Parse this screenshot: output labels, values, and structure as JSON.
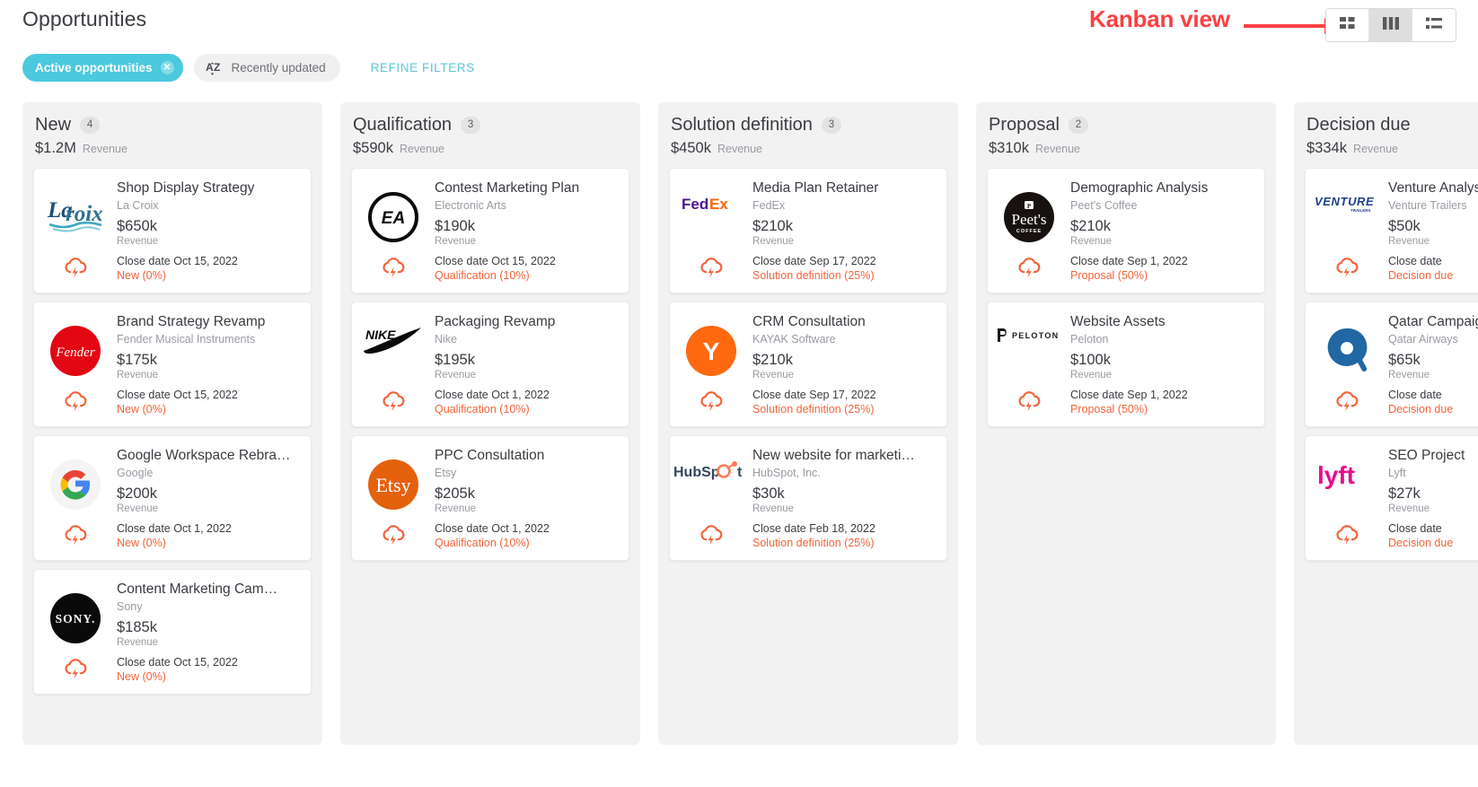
{
  "header": {
    "title": "Opportunities",
    "filters": {
      "active_chip": "Active opportunities",
      "chip_close_icon": "close-circle-icon",
      "sort_icon": "sort-az-icon",
      "sort_label": "Recently updated",
      "refine_link": "REFINE FILTERS"
    },
    "view_toggle": {
      "buttons": [
        {
          "name": "grid-view",
          "icon": "grid-view-icon",
          "selected": false
        },
        {
          "name": "kanban-view",
          "icon": "kanban-view-icon",
          "selected": true
        },
        {
          "name": "list-view",
          "icon": "list-view-icon",
          "selected": false
        }
      ]
    },
    "annotation": {
      "label": "Kanban view",
      "color": "#fc4043",
      "icon": "arrow-right-icon"
    }
  },
  "colors": {
    "accent_teal": "#4BC9DE",
    "stage_orange": "#f4633a",
    "column_bg": "#f2f2f2",
    "annotation_red": "#fc4043"
  },
  "revenue_label": "Revenue",
  "board": {
    "columns": [
      {
        "title": "New",
        "count": "4",
        "revenue": "$1.2M",
        "revenue_label": "Revenue",
        "cards": [
          {
            "title": "Shop Display Strategy",
            "company": "La Croix",
            "amount": "$650k",
            "amount_label": "Revenue",
            "close_date": "Close date Oct 15, 2022",
            "stage": "New (0%)",
            "logo": "lacroix-logo"
          },
          {
            "title": "Brand Strategy Revamp",
            "company": "Fender Musical Instruments",
            "amount": "$175k",
            "amount_label": "Revenue",
            "close_date": "Close date Oct 15, 2022",
            "stage": "New (0%)",
            "logo": "fender-logo"
          },
          {
            "title": "Google Workspace Rebra…",
            "company": "Google",
            "amount": "$200k",
            "amount_label": "Revenue",
            "close_date": "Close date Oct 1, 2022",
            "stage": "New (0%)",
            "logo": "google-logo"
          },
          {
            "title": "Content Marketing Cam…",
            "company": "Sony",
            "amount": "$185k",
            "amount_label": "Revenue",
            "close_date": "Close date Oct 15, 2022",
            "stage": "New (0%)",
            "logo": "sony-logo"
          }
        ]
      },
      {
        "title": "Qualification",
        "count": "3",
        "revenue": "$590k",
        "revenue_label": "Revenue",
        "cards": [
          {
            "title": "Contest Marketing Plan",
            "company": "Electronic Arts",
            "amount": "$190k",
            "amount_label": "Revenue",
            "close_date": "Close date Oct 15, 2022",
            "stage": "Qualification (10%)",
            "logo": "ea-logo"
          },
          {
            "title": "Packaging Revamp",
            "company": "Nike",
            "amount": "$195k",
            "amount_label": "Revenue",
            "close_date": "Close date Oct 1, 2022",
            "stage": "Qualification (10%)",
            "logo": "nike-logo"
          },
          {
            "title": "PPC Consultation",
            "company": "Etsy",
            "amount": "$205k",
            "amount_label": "Revenue",
            "close_date": "Close date Oct 1, 2022",
            "stage": "Qualification (10%)",
            "logo": "etsy-logo"
          }
        ]
      },
      {
        "title": "Solution definition",
        "count": "3",
        "revenue": "$450k",
        "revenue_label": "Revenue",
        "cards": [
          {
            "title": "Media Plan Retainer",
            "company": "FedEx",
            "amount": "$210k",
            "amount_label": "Revenue",
            "close_date": "Close date Sep 17, 2022",
            "stage": "Solution definition (25%)",
            "logo": "fedex-logo"
          },
          {
            "title": "CRM Consultation",
            "company": "KAYAK Software",
            "amount": "$210k",
            "amount_label": "Revenue",
            "close_date": "Close date Sep 17, 2022",
            "stage": "Solution definition (25%)",
            "logo": "kayak-logo"
          },
          {
            "title": "New website for marketi…",
            "company": "HubSpot, Inc.",
            "amount": "$30k",
            "amount_label": "Revenue",
            "close_date": "Close date Feb 18, 2022",
            "stage": "Solution definition (25%)",
            "logo": "hubspot-logo"
          }
        ]
      },
      {
        "title": "Proposal",
        "count": "2",
        "revenue": "$310k",
        "revenue_label": "Revenue",
        "cards": [
          {
            "title": "Demographic Analysis",
            "company": "Peet's Coffee",
            "amount": "$210k",
            "amount_label": "Revenue",
            "close_date": "Close date Sep 1, 2022",
            "stage": "Proposal (50%)",
            "logo": "peets-logo"
          },
          {
            "title": "Website Assets",
            "company": "Peloton",
            "amount": "$100k",
            "amount_label": "Revenue",
            "close_date": "Close date Sep 1, 2022",
            "stage": "Proposal (50%)",
            "logo": "peloton-logo"
          }
        ]
      },
      {
        "title": "Decision due",
        "count": "",
        "revenue": "$334k",
        "revenue_label": "Revenue",
        "cards": [
          {
            "title": "Venture Analysis",
            "company": "Venture Trailers",
            "amount": "$50k",
            "amount_label": "Revenue",
            "close_date": "Close date",
            "stage": "Decision due",
            "logo": "venture-logo"
          },
          {
            "title": "Qatar Campaign",
            "company": "Qatar Airways",
            "amount": "$65k",
            "amount_label": "Revenue",
            "close_date": "Close date",
            "stage": "Decision due",
            "logo": "qatar-logo"
          },
          {
            "title": "SEO Project",
            "company": "Lyft",
            "amount": "$27k",
            "amount_label": "Revenue",
            "close_date": "Close date",
            "stage": "Decision due",
            "logo": "lyft-logo"
          }
        ]
      }
    ]
  }
}
